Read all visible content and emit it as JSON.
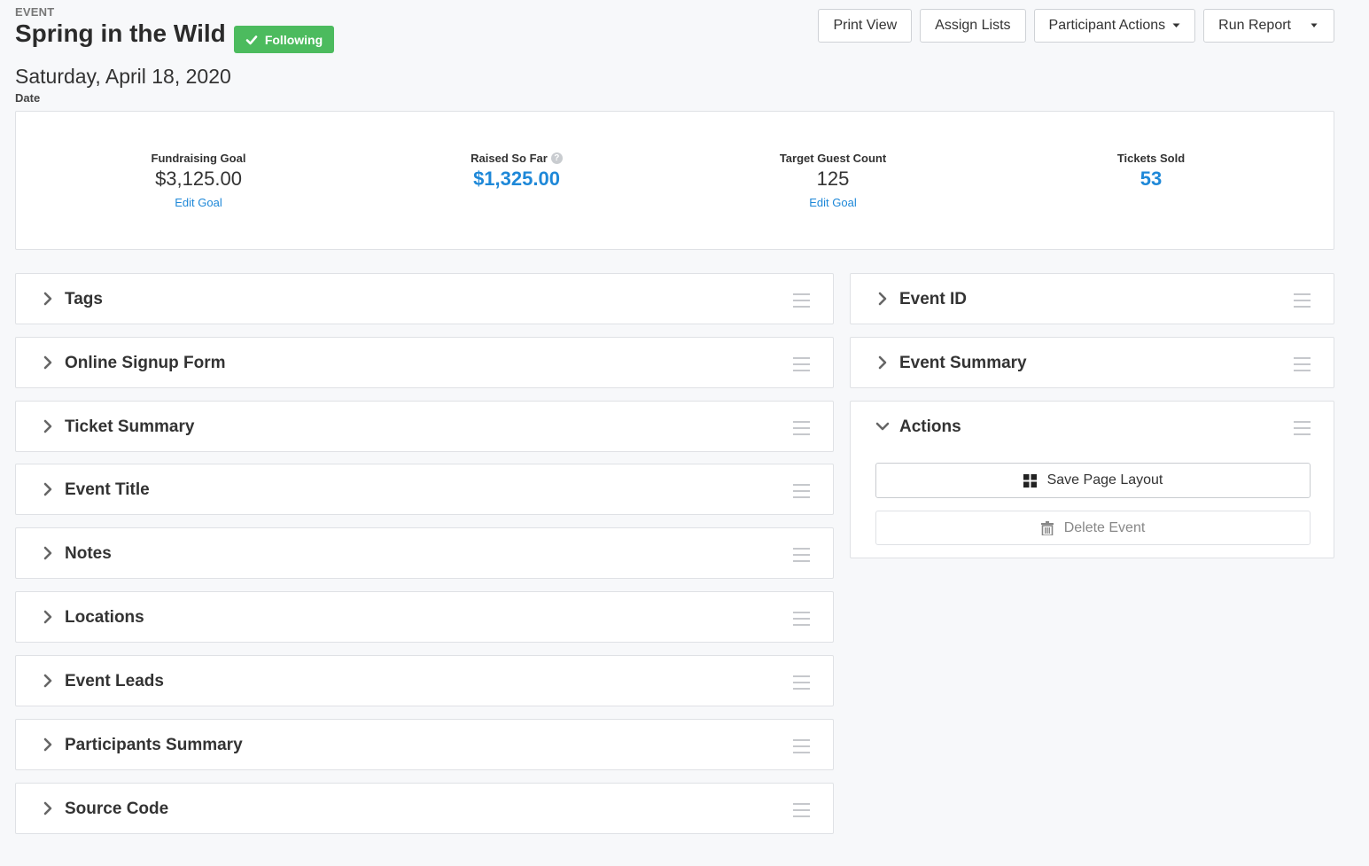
{
  "header": {
    "eyebrow": "EVENT",
    "title": "Spring in the Wild",
    "badge": "Following",
    "date": "Saturday, April 18, 2020",
    "date_label": "Date"
  },
  "toolbar": {
    "print_view": "Print View",
    "assign_lists": "Assign Lists",
    "participant_actions": "Participant Actions",
    "run_report": "Run Report"
  },
  "stats": [
    {
      "label": "Fundraising Goal",
      "value": "$3,125.00",
      "link": "Edit Goal"
    },
    {
      "label": "Raised So Far",
      "value": "$1,325.00",
      "link": ""
    },
    {
      "label": "Target Guest Count",
      "value": "125",
      "link": "Edit Goal"
    },
    {
      "label": "Tickets Sold",
      "value": "53",
      "link": ""
    }
  ],
  "left_panels": [
    "Tags",
    "Online Signup Form",
    "Ticket Summary",
    "Event Title",
    "Notes",
    "Locations",
    "Event Leads",
    "Participants Summary",
    "Source Code"
  ],
  "right_panels": [
    "Event ID",
    "Event Summary",
    "Actions"
  ],
  "actions": {
    "save_layout": "Save Page Layout",
    "delete_event": "Delete Event"
  },
  "colors": {
    "accent_blue": "#1e88d8",
    "badge_green": "#4cbb5e"
  }
}
